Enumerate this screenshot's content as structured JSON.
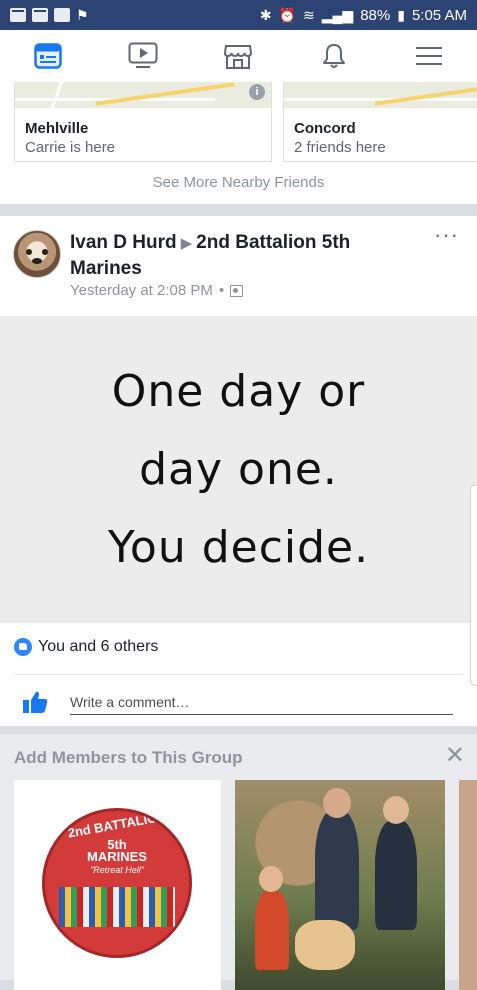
{
  "status_bar": {
    "icons_left": [
      "mail-icon",
      "mail-icon",
      "image-icon",
      "flag-icon"
    ],
    "battery": "88%",
    "time": "5:05 AM"
  },
  "nav": {
    "items": [
      "news-feed-icon",
      "watch-icon",
      "marketplace-icon",
      "notifications-icon",
      "menu-icon"
    ],
    "active_color": "#1877f2",
    "inactive_color": "#606770"
  },
  "nearby": {
    "friends": [
      {
        "city": "Mehlville",
        "status": "Carrie is here"
      },
      {
        "city": "Concord",
        "status": "2 friends here"
      }
    ],
    "see_more": "See More Nearby Friends"
  },
  "post": {
    "author": "Ivan D Hurd",
    "group": "2nd Battalion 5th Marines",
    "timestamp": "Yesterday at 2:08 PM",
    "separator": "•",
    "image_text": [
      "One day or",
      "day one.",
      "You decide."
    ],
    "reactions": "You and 6 others",
    "comment_placeholder": "Write a comment…"
  },
  "add_members": {
    "title": "Add Members to This Group",
    "badge": {
      "arc_text": "2nd BATTALION",
      "line1": "5th",
      "line2": "MARINES",
      "motto": "\"Retreat Hell\""
    }
  }
}
